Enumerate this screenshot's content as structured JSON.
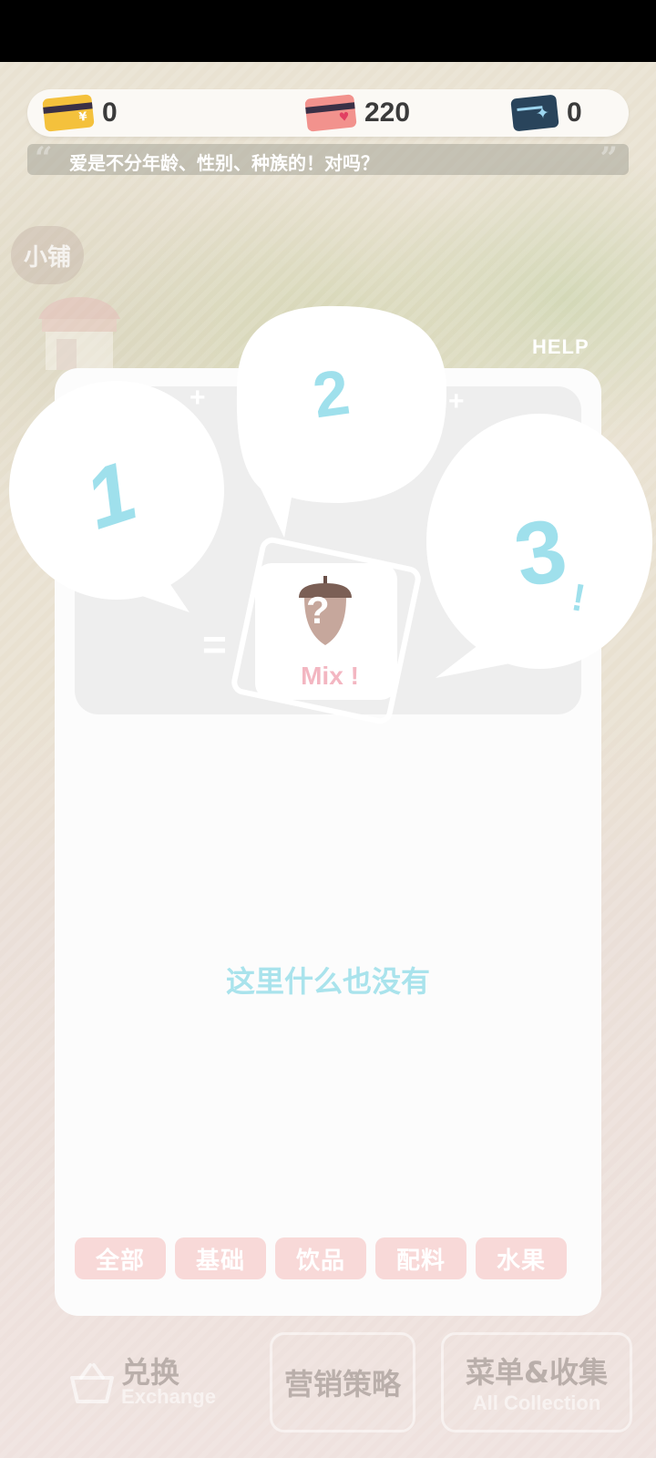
{
  "currency": [
    {
      "icon": "gold-card-icon",
      "value": "0"
    },
    {
      "icon": "heart-card-icon",
      "value": "220"
    },
    {
      "icon": "sparkle-card-icon",
      "value": "0"
    }
  ],
  "quote": {
    "text": "爱是不分年龄、性别、种族的！对吗？"
  },
  "shop": {
    "label": "小铺"
  },
  "help": {
    "label": "HELP"
  },
  "mix": {
    "slot_labels": [
      "1",
      "2",
      "3"
    ],
    "exclaim": "!",
    "plus": "+",
    "equals": "=",
    "question": "?",
    "result_label": "Mix !"
  },
  "empty": {
    "text": "这里什么也没有"
  },
  "tabs": [
    {
      "label": "全部"
    },
    {
      "label": "基础"
    },
    {
      "label": "饮品"
    },
    {
      "label": "配料"
    },
    {
      "label": "水果"
    }
  ],
  "nav": {
    "exchange": {
      "cn": "兑换",
      "en": "Exchange"
    },
    "marketing": {
      "cn": "营销策略"
    },
    "menu": {
      "cn": "菜单&收集",
      "en": "All Collection"
    }
  },
  "colors": {
    "accent_blue": "#9fe0ec",
    "tab_pink": "#f8d9d8",
    "mix_pink": "#f3b6c1"
  }
}
